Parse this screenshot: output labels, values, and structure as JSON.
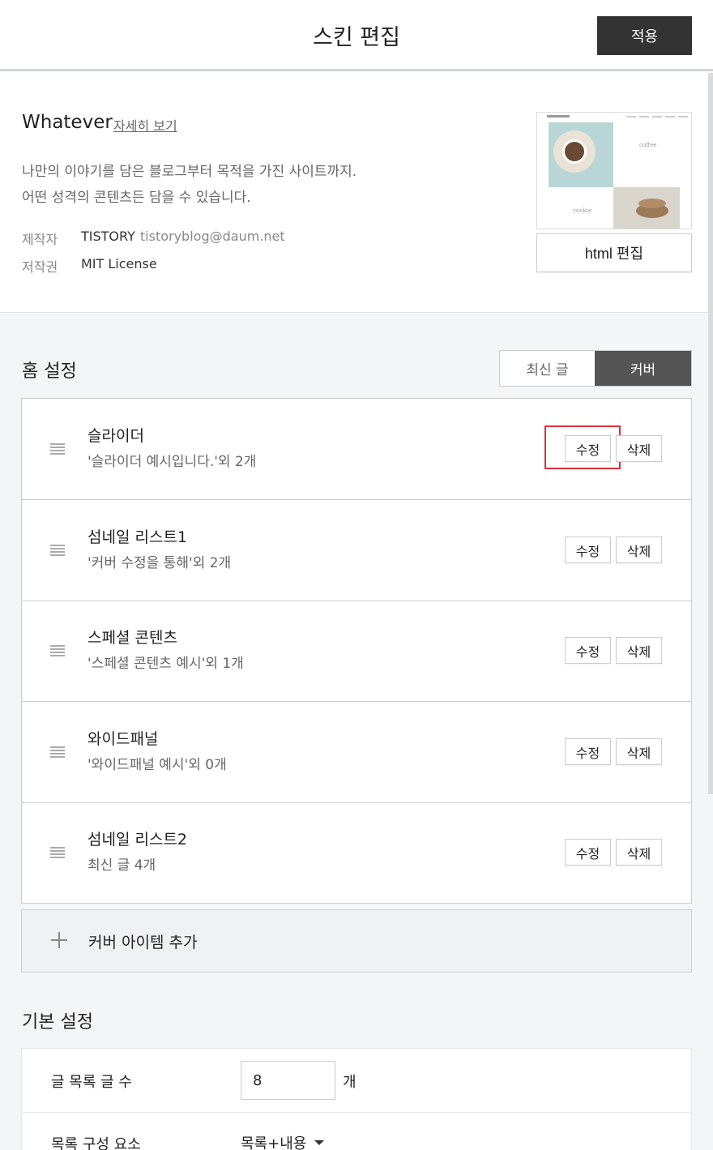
{
  "header": {
    "title": "스킨 편집",
    "apply_label": "적용"
  },
  "skin": {
    "name": "Whatever",
    "detail_link": "자세히 보기",
    "desc_line1": "나만의 이야기를 담은 블로그부터 목적을 가진 사이트까지.",
    "desc_line2": "어떤 성격의 콘텐츠든 담을 수 있습니다.",
    "author_key": "제작자",
    "author_name": "TISTORY",
    "author_email": "tistoryblog@daum.net",
    "license_key": "저작권",
    "license_val": "MIT License",
    "thumb_coffee": "coffee",
    "thumb_cookie": "cookie",
    "html_edit_label": "html 편집"
  },
  "home": {
    "title": "홈 설정",
    "toggle": {
      "latest": "최신 글",
      "cover": "커버",
      "selected": "커버"
    },
    "items": [
      {
        "title": "슬라이더",
        "sub": "'슬라이더 예시입니다.'외 2개",
        "edit": "수정",
        "delete": "삭제"
      },
      {
        "title": "섬네일 리스트1",
        "sub": "'커버 수정을 통해'외 2개",
        "edit": "수정",
        "delete": "삭제"
      },
      {
        "title": "스페셜 콘텐츠",
        "sub": "'스페셜 콘텐츠 예시'외 1개",
        "edit": "수정",
        "delete": "삭제"
      },
      {
        "title": "와이드패널",
        "sub": "'와이드패널 예시'외 0개",
        "edit": "수정",
        "delete": "삭제"
      },
      {
        "title": "섬네일 리스트2",
        "sub": "최신 글 4개",
        "edit": "수정",
        "delete": "삭제"
      }
    ],
    "add_label": "커버 아이템 추가"
  },
  "basic": {
    "title": "기본 설정",
    "post_count_label": "글 목록 글 수",
    "post_count_value": "8",
    "post_count_unit": "개",
    "list_comp_label": "목록 구성 요소",
    "list_comp_value": "목록+내용"
  },
  "colors": {
    "primary_dark": "#333333",
    "highlight": "#e0303a"
  }
}
